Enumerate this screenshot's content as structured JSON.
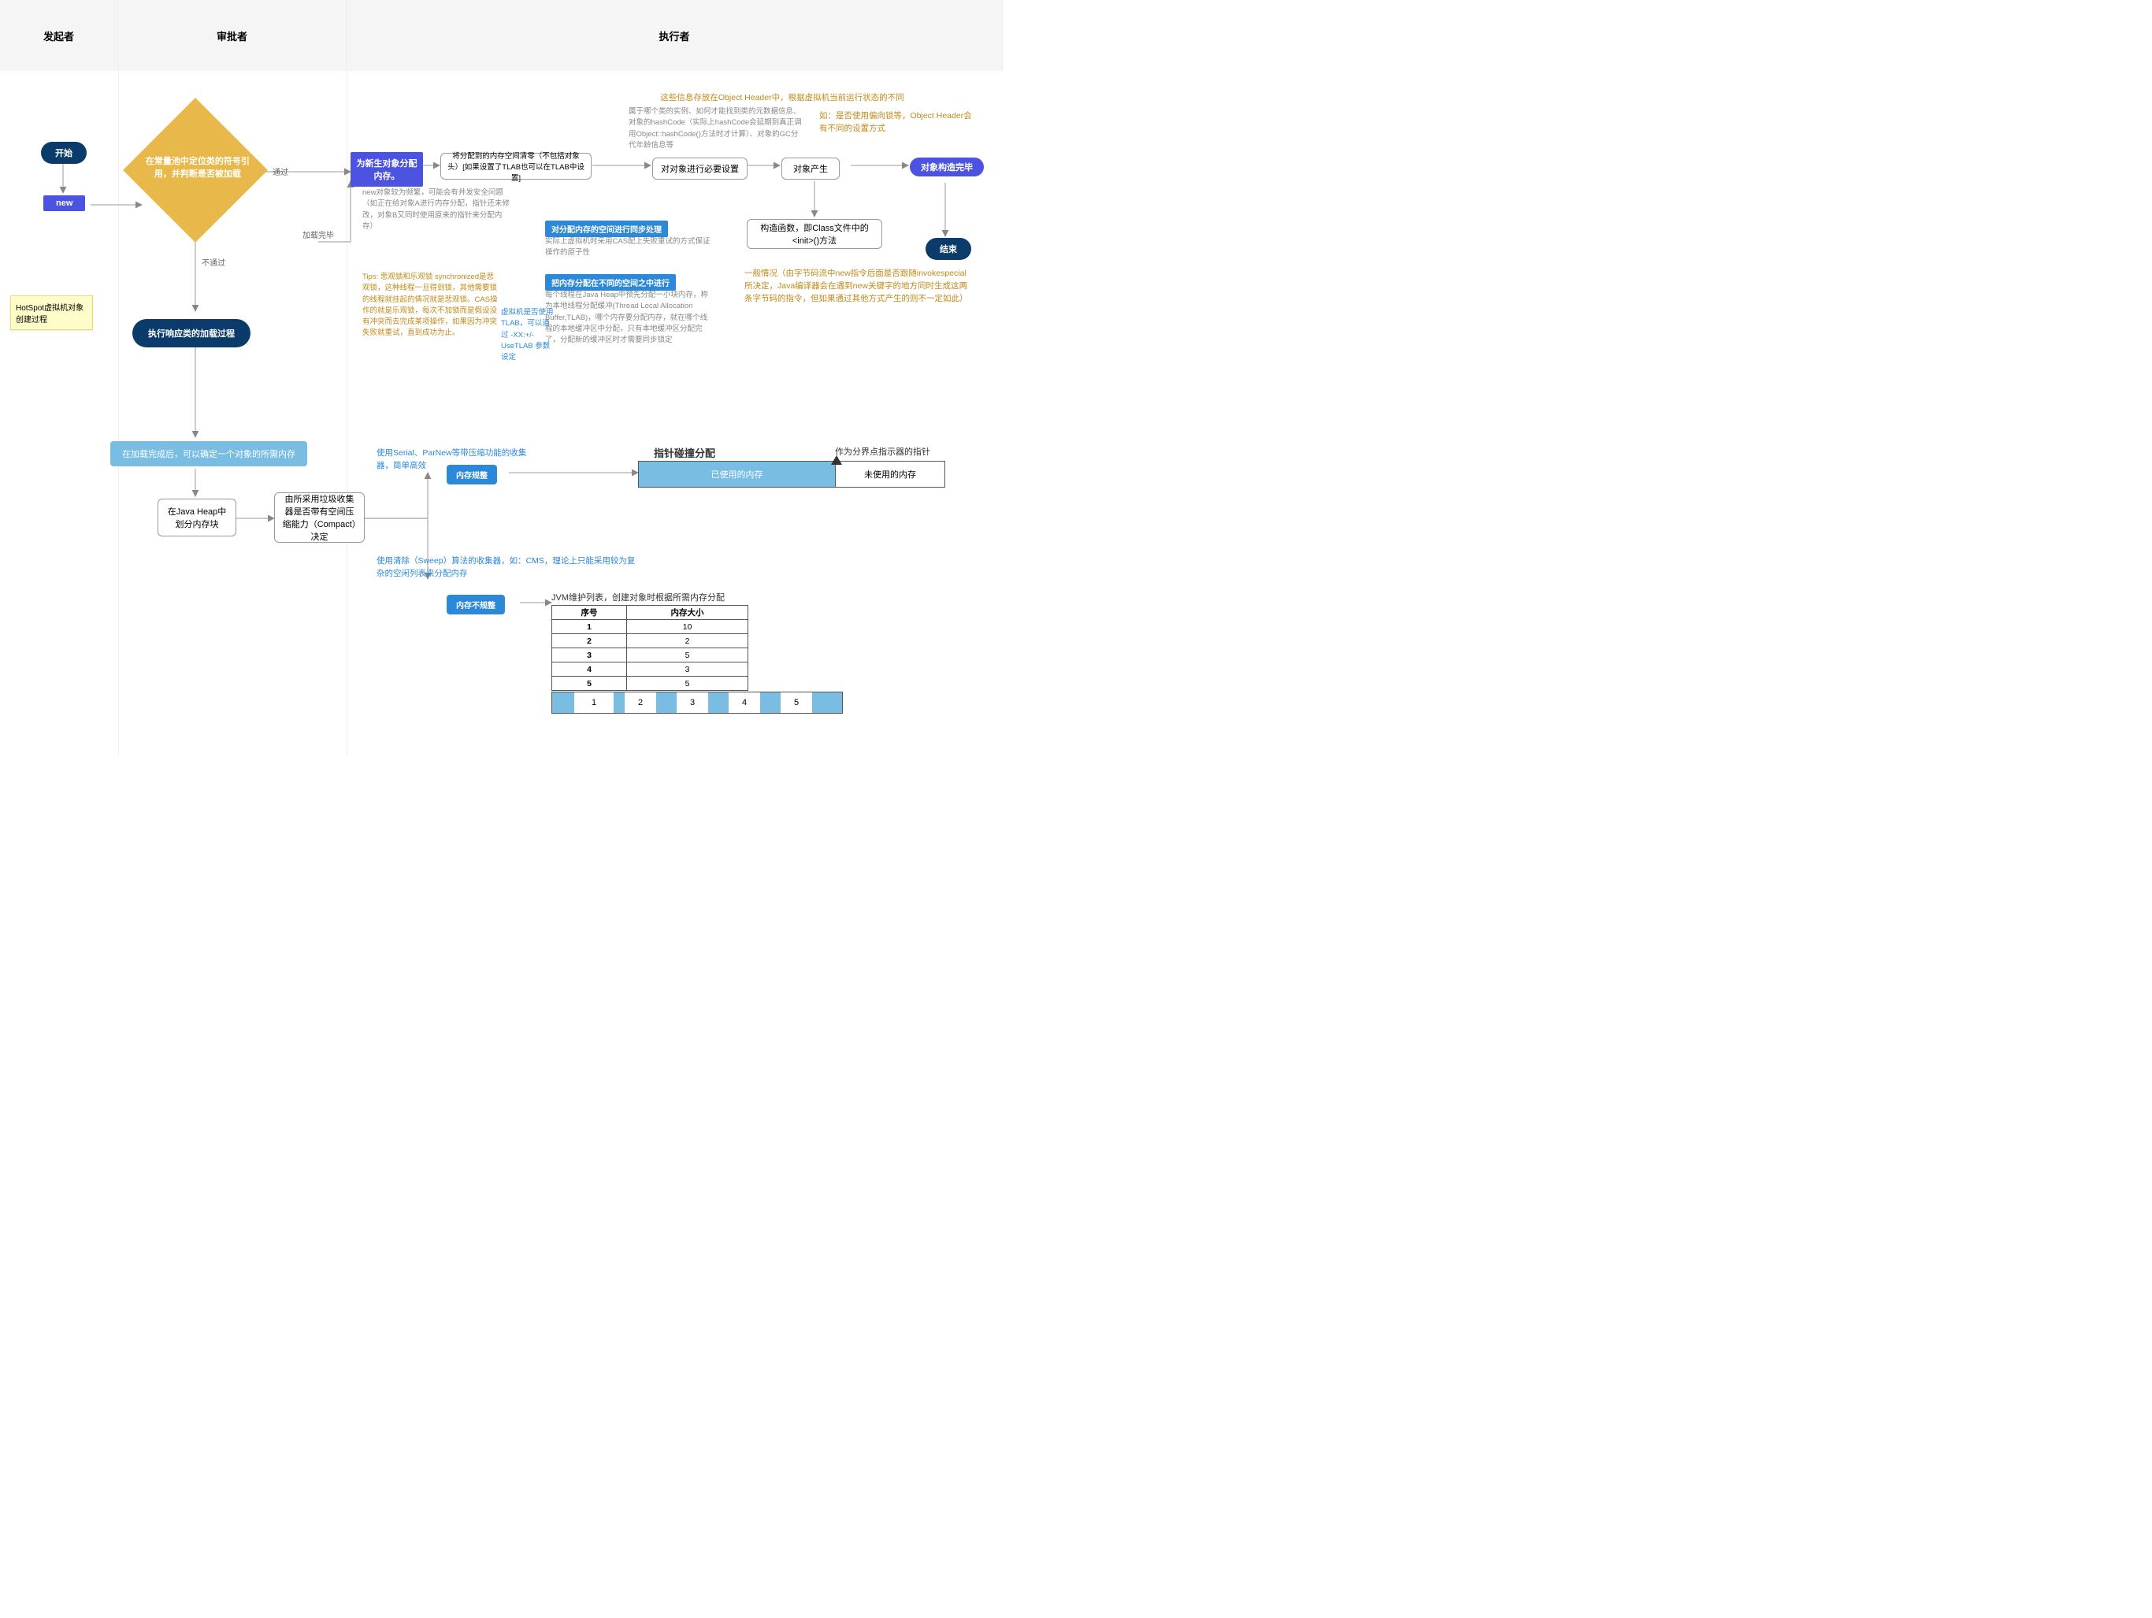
{
  "lanes": {
    "l1": "发起者",
    "l2": "审批者",
    "l3": "执行者"
  },
  "start": "开始",
  "new_kw": "new",
  "note": "HotSpot虚拟机对象创建过程",
  "diamond": "在常量池中定位类的符号引用，并判断是否被加载",
  "diamond_pass": "通过",
  "diamond_fail": "不通过",
  "load_process": "执行响应类的加载过程",
  "load_done": "加载完毕",
  "after_load": "在加载完成后，可以确定一个对象的所需内存",
  "alloc_heap": "在Java Heap中划分内存块",
  "compact_decide": "由所采用垃圾收集器是否带有空间压缩能力（Compact）决定",
  "alloc_new": "为新生对象分配内存。",
  "zero_mem": "将分配到的内存空间清零（不包括对象头）[如果设置了TLAB也可以在TLAB中设置]",
  "set_obj": "对对象进行必要设置",
  "obj_born": "对象产生",
  "ctor": "构造函数，即Class文件中的<init>()方法",
  "done": "对象构造完毕",
  "end": "结束",
  "anno_header1": "这些信息存放在Object Header中，根据虚拟机当前运行状态的不同",
  "anno_header1_grey": "属于哪个类的实例、如何才能找到类的元数据信息、对象的hashCode（实际上hashCode会延期到真正调用Object::hashCode()方法时才计算）、对象的GC分代年龄信息等",
  "anno_header2": "如：是否使用偏向锁等，Object Header会有不同的设置方式",
  "anno_end": "一般情况（由字节码流中new指令后面是否跟随invokespecial所决定，Java编译器会在遇到new关键字的地方同时生成这两条字节码的指令，但如果通过其他方式产生的则不一定如此）",
  "anno_freq": "new对象较为频繁，可能会有并发安全问题（如正在给对象A进行内存分配，指针还未修改，对象B又同时使用原来的指针来分配内存）",
  "anno_lock_tips": "Tips: 悲观锁和乐观锁 synchronized是悲观锁，这种线程一旦得到锁，其他需要锁的线程就挂起的情况就是悲观锁。CAS操作的就是乐观锁，每次不加锁而是假设没有冲突而去完成某项操作，如果因为冲突失败就重试，直到成功为止。",
  "anno_tlab": "虚拟机是否使用TLAB，可以通过 -XX:+/-UseTLAB 参数设定",
  "sync_tag": "对分配内存的空间进行同步处理",
  "sync_desc": "实际上虚拟机时采用CAS配上失败重试的方式保证操作的原子性",
  "tlab_tag": "把内存分配在不同的空间之中进行",
  "tlab_desc": "每个线程在Java Heap中预先分配一小块内存，称为本地线程分配缓冲(Thread Local Allocation Buffer,TLAB)，哪个内存要分配内存，就在哪个线程的本地缓冲区中分配，只有本地缓冲区分配完了，分配新的缓冲区时才需要同步锁定",
  "regular_label": "内存规整",
  "regular_anno": "使用Serial、ParNew等带压缩功能的收集器，简单高效",
  "regular_title": "指针碰撞分配",
  "regular_ptr": "作为分界点指示器的指针",
  "mem_used": "已使用的内存",
  "mem_free": "未使用的内存",
  "irregular_label": "内存不规整",
  "irregular_anno": "使用清除（Sweep）算法的收集器，如：CMS，理论上只能采用较为复杂的空闲列表来分配内存",
  "freelist_title": "JVM维护列表，创建对象时根据所需内存分配",
  "table": {
    "cols": [
      "序号",
      "内存大小"
    ],
    "rows": [
      [
        "1",
        "10"
      ],
      [
        "2",
        "2"
      ],
      [
        "3",
        "5"
      ],
      [
        "4",
        "3"
      ],
      [
        "5",
        "5"
      ]
    ]
  },
  "chart_data": {
    "type": "table",
    "title": "JVM维护列表，创建对象时根据所需内存分配",
    "columns": [
      "序号",
      "内存大小"
    ],
    "rows": [
      [
        1,
        10
      ],
      [
        2,
        2
      ],
      [
        3,
        5
      ],
      [
        4,
        3
      ],
      [
        5,
        5
      ]
    ]
  },
  "blocks": [
    "1",
    "2",
    "3",
    "4",
    "5"
  ]
}
